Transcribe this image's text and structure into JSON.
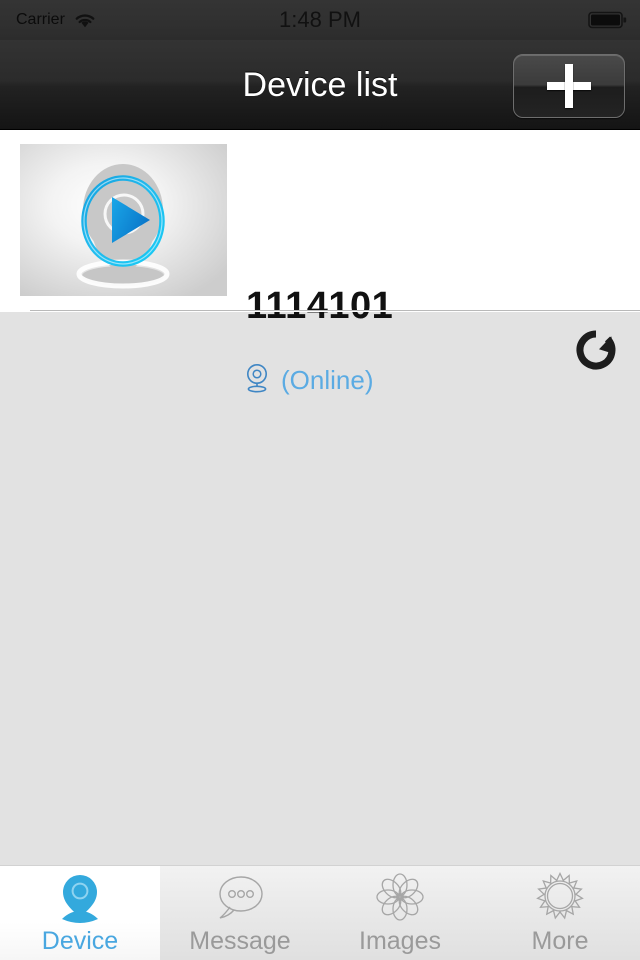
{
  "status_bar": {
    "carrier": "Carrier",
    "wifi_icon": "wifi-icon",
    "time": "1:48 PM",
    "battery_icon": "battery-full-icon"
  },
  "nav_bar": {
    "title": "Device list",
    "add_button_label": "+",
    "add_button_icon": "plus-icon"
  },
  "device_list": {
    "rows": [
      {
        "name": "1114101",
        "status": "(Online)",
        "status_icon": "webcam-icon",
        "refresh_icon": "refresh-icon",
        "thumbnail_icon": "camera-play-thumbnail"
      }
    ]
  },
  "tab_bar": {
    "tabs": [
      {
        "label": "Device",
        "icon": "webcam-pin-icon",
        "active": true
      },
      {
        "label": "Message",
        "icon": "speech-bubble-icon",
        "active": false
      },
      {
        "label": "Images",
        "icon": "flower-rosette-icon",
        "active": false
      },
      {
        "label": "More",
        "icon": "sun-gear-icon",
        "active": false
      }
    ]
  },
  "colors": {
    "accent_blue": "#49a7e0",
    "status_blue": "#5babe3",
    "nav_bar_dark": "#222222",
    "list_background": "#e2e2e2",
    "row_background": "#ffffff",
    "inactive_tab_grey": "#9a9a9a"
  }
}
